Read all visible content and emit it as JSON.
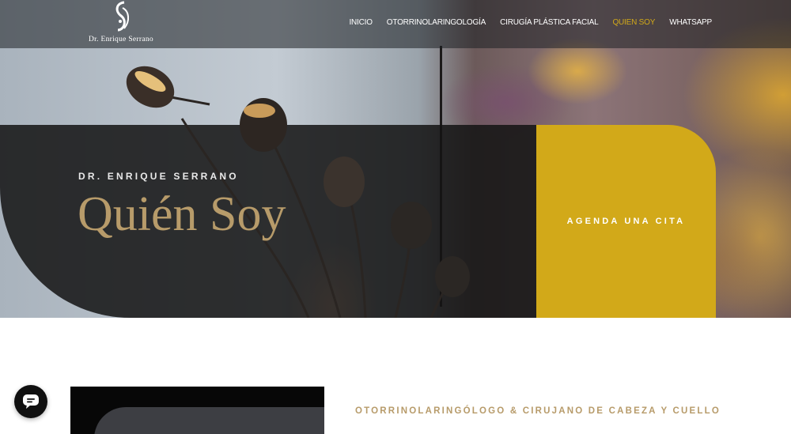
{
  "header": {
    "logo_text": "Dr. Enrique Serrano",
    "nav": [
      {
        "label": "INICIO",
        "active": false
      },
      {
        "label": "OTORRINOLARINGOLOGÍA",
        "active": false
      },
      {
        "label": "CIRUGÍA PLÁSTICA FACIAL",
        "active": false
      },
      {
        "label": "QUIEN SOY",
        "active": true
      },
      {
        "label": "WHATSAPP",
        "active": false
      }
    ]
  },
  "hero": {
    "kicker": "DR. ENRIQUE SERRANO",
    "title": "Quién Soy",
    "cta_label": "AGENDA UNA CITA"
  },
  "content": {
    "subheading": "OTORRINOLARINGÓLOGO & CIRUJANO DE CABEZA Y CUELLO"
  },
  "chat": {
    "icon": "chat-bubble-icon"
  },
  "colors": {
    "accent_gold": "#d2a919",
    "title_gold": "#b79b6a",
    "banner_dark": "#141414"
  }
}
